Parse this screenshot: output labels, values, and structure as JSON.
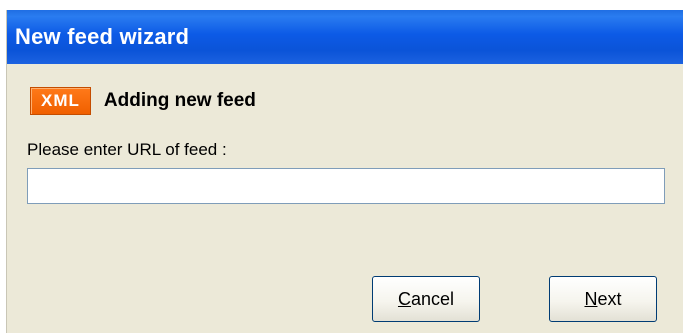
{
  "window": {
    "title": "New feed wizard"
  },
  "header": {
    "badge": "XML",
    "title": "Adding new feed"
  },
  "form": {
    "prompt": "Please enter URL of feed :",
    "url_value": "",
    "url_placeholder": ""
  },
  "buttons": {
    "cancel_mnemonic": "C",
    "cancel_rest": "ancel",
    "next_mnemonic": "N",
    "next_rest": "ext"
  },
  "colors": {
    "titlebar": "#0b54d8",
    "dialog_bg": "#ece9d8",
    "badge": "#f06000"
  }
}
